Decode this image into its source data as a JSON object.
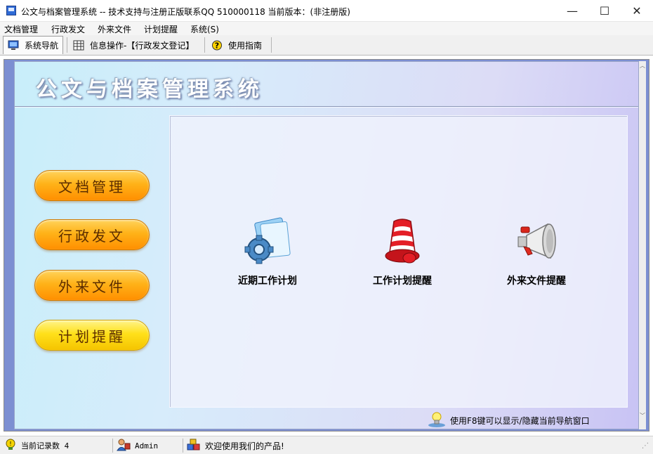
{
  "window": {
    "title": "公文与档案管理系统 -- 技术支持与注册正版联系QQ 510000118    当前版本：(非注册版)",
    "minimize": "—",
    "maximize": "☐",
    "close": "✕"
  },
  "menu": {
    "items": [
      {
        "label": "文档管理"
      },
      {
        "label": "行政发文"
      },
      {
        "label": "外来文件"
      },
      {
        "label": "计划提醒"
      },
      {
        "label": "系统(S)"
      }
    ]
  },
  "tabs": [
    {
      "label": "系统导航",
      "icon": "monitor-icon",
      "active": true
    },
    {
      "label": "信息操作-【行政发文登记】",
      "icon": "grid-icon",
      "active": false
    },
    {
      "label": "使用指南",
      "icon": "help-icon",
      "active": false
    }
  ],
  "main": {
    "system_title": "公文与档案管理系统",
    "nav_buttons": [
      {
        "label": "文档管理",
        "color": "#ffb218"
      },
      {
        "label": "行政发文",
        "color": "#ffb218"
      },
      {
        "label": "外来文件",
        "color": "#ffb218"
      },
      {
        "label": "计划提醒",
        "color": "#ffe01a"
      }
    ],
    "features": [
      {
        "label": "近期工作计划",
        "icon": "gear-document-icon"
      },
      {
        "label": "工作计划提醒",
        "icon": "bell-icon"
      },
      {
        "label": "外来文件提醒",
        "icon": "megaphone-icon"
      }
    ],
    "hint": "使用F8键可以显示/隐藏当前导航窗口",
    "hint_icon": "lightbulb-icon"
  },
  "statusbar": {
    "record_count": "当前记录数 4",
    "user": "Admin",
    "welcome": "欢迎使用我们的产品!"
  }
}
